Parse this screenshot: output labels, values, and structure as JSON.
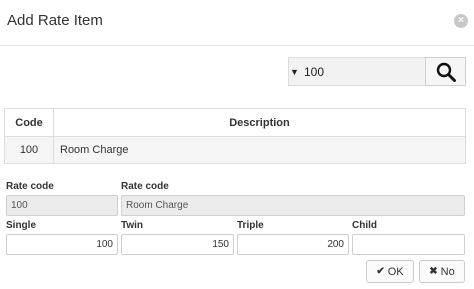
{
  "dialog": {
    "title": "Add Rate Item",
    "close_symbol": "×"
  },
  "search": {
    "caret_symbol": "▼",
    "value": "100",
    "icon": "search-icon"
  },
  "table": {
    "headers": {
      "code": "Code",
      "description": "Description"
    },
    "rows": [
      {
        "code": "100",
        "description": "Room Charge"
      }
    ]
  },
  "form": {
    "rate_code_label": "Rate code",
    "rate_code_value": "100",
    "rate_desc_label": "Rate code",
    "rate_desc_value": "Room Charge",
    "single_label": "Single",
    "single_value": "100",
    "twin_label": "Twin",
    "twin_value": "150",
    "triple_label": "Triple",
    "triple_value": "200",
    "child_label": "Child",
    "child_value": ""
  },
  "buttons": {
    "ok_label": "OK",
    "ok_icon": "✔",
    "no_label": "No",
    "no_icon": "✖"
  }
}
